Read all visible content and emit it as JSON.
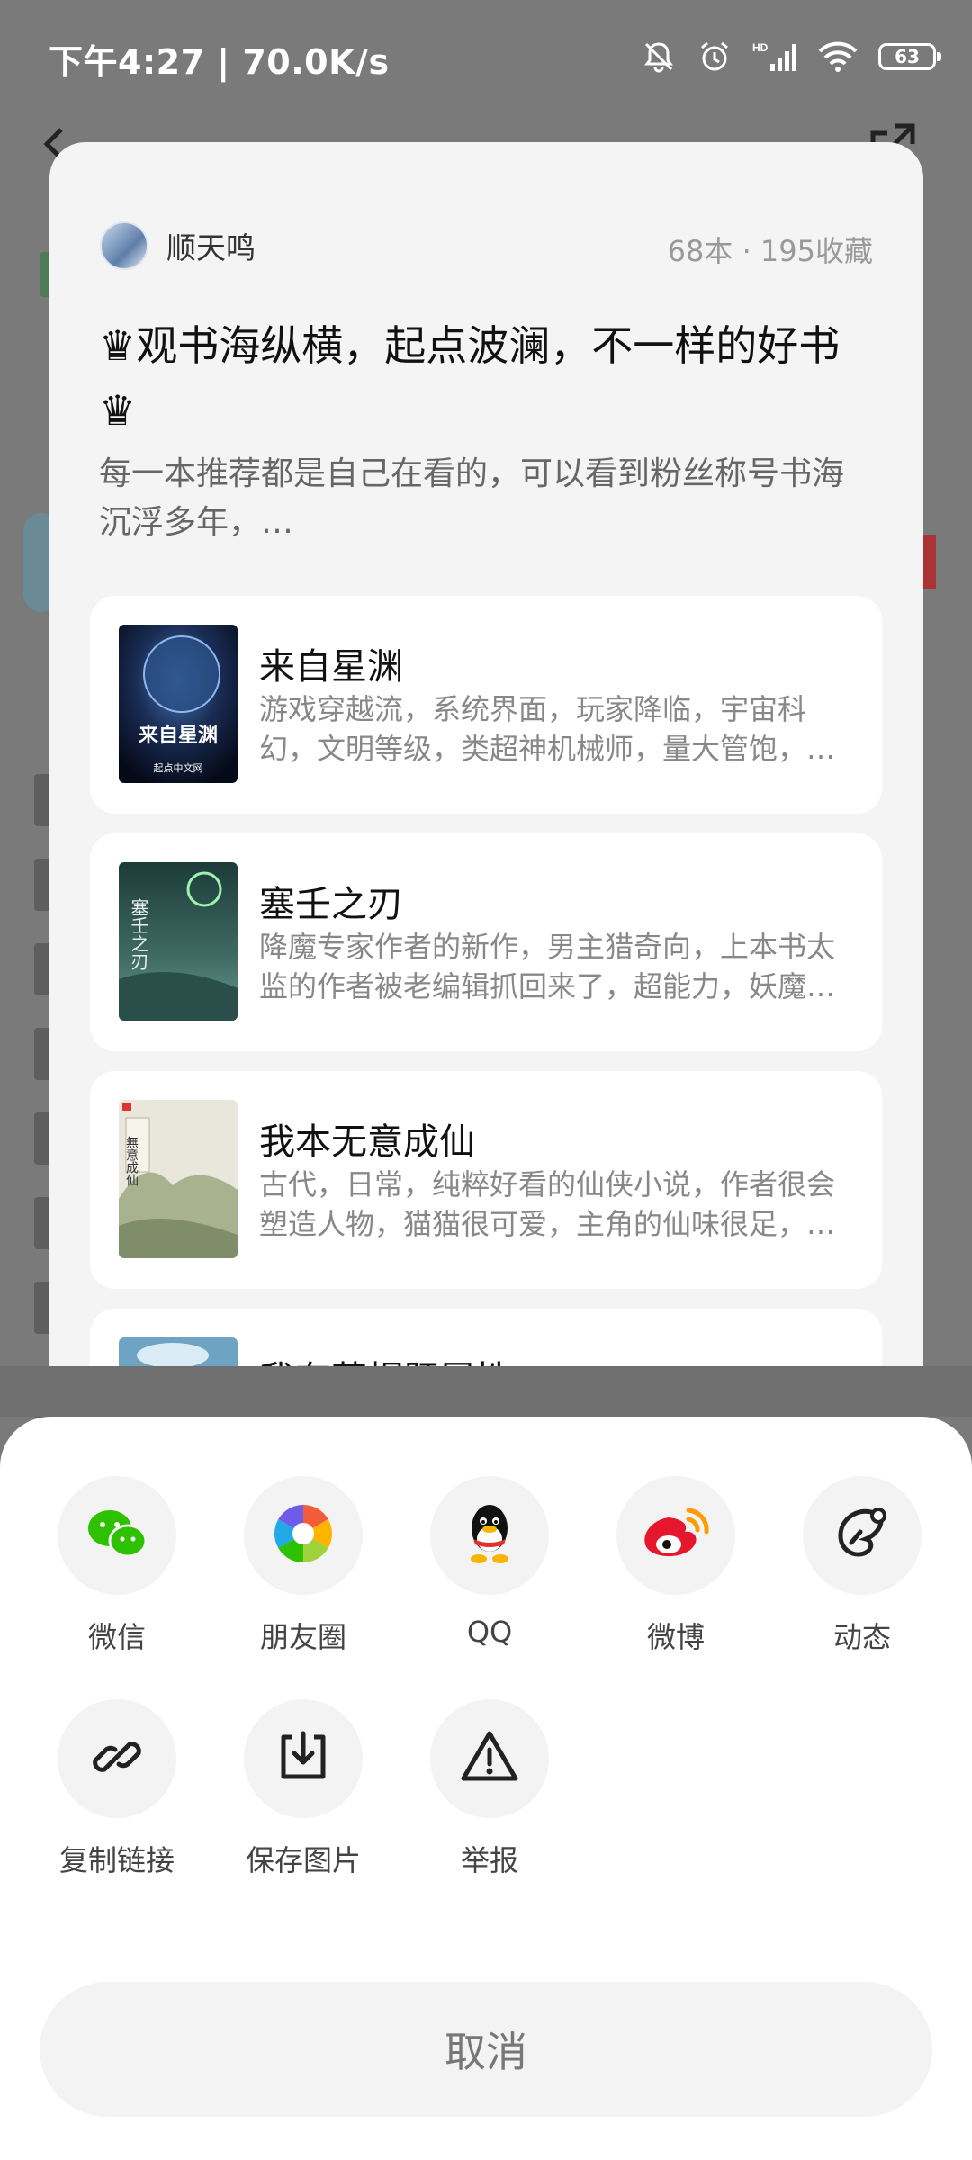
{
  "status_bar": {
    "time_speed": "下午4:27 | 70.0K/s",
    "battery": "63",
    "icons": [
      "mute-icon",
      "alarm-icon",
      "hd-signal-icon",
      "wifi-icon",
      "battery-icon"
    ]
  },
  "card": {
    "author_name": "顺天鸣",
    "stats": "68本 · 195收藏",
    "title": "♛观书海纵横，起点波澜，不一样的好书♛",
    "description": "每一本推荐都是自己在看的，可以看到粉丝称号书海沉浮多年，…",
    "books": [
      {
        "title": "来自星渊",
        "description": "游戏穿越流，系统界面，玩家降临，宇宙科幻，文明等级，类超神机械师，量大管饱，…",
        "cover_text": "来自星渊",
        "cover_publisher": "起点中文网"
      },
      {
        "title": "塞壬之刃",
        "description": "降魔专家作者的新作，男主猎奇向，上本书太监的作者被老编辑抓回来了，超能力，妖魔…",
        "cover_text": "塞壬之刃"
      },
      {
        "title": "我本无意成仙",
        "description": "古代，日常，纯粹好看的仙侠小说，作者很会塑造人物，猫猫很可爱，主角的仙味很足，…",
        "cover_text": "無意成仙"
      },
      {
        "title": "我有草帽肝属性",
        "description": ""
      }
    ]
  },
  "share": {
    "row1": [
      {
        "label": "微信",
        "icon": "wechat-icon"
      },
      {
        "label": "朋友圈",
        "icon": "moments-icon"
      },
      {
        "label": "QQ",
        "icon": "qq-icon"
      },
      {
        "label": "微博",
        "icon": "weibo-icon"
      },
      {
        "label": "动态",
        "icon": "feed-icon"
      }
    ],
    "row2": [
      {
        "label": "复制链接",
        "icon": "link-icon"
      },
      {
        "label": "保存图片",
        "icon": "save-image-icon"
      },
      {
        "label": "举报",
        "icon": "report-icon"
      }
    ],
    "cancel_label": "取消"
  }
}
